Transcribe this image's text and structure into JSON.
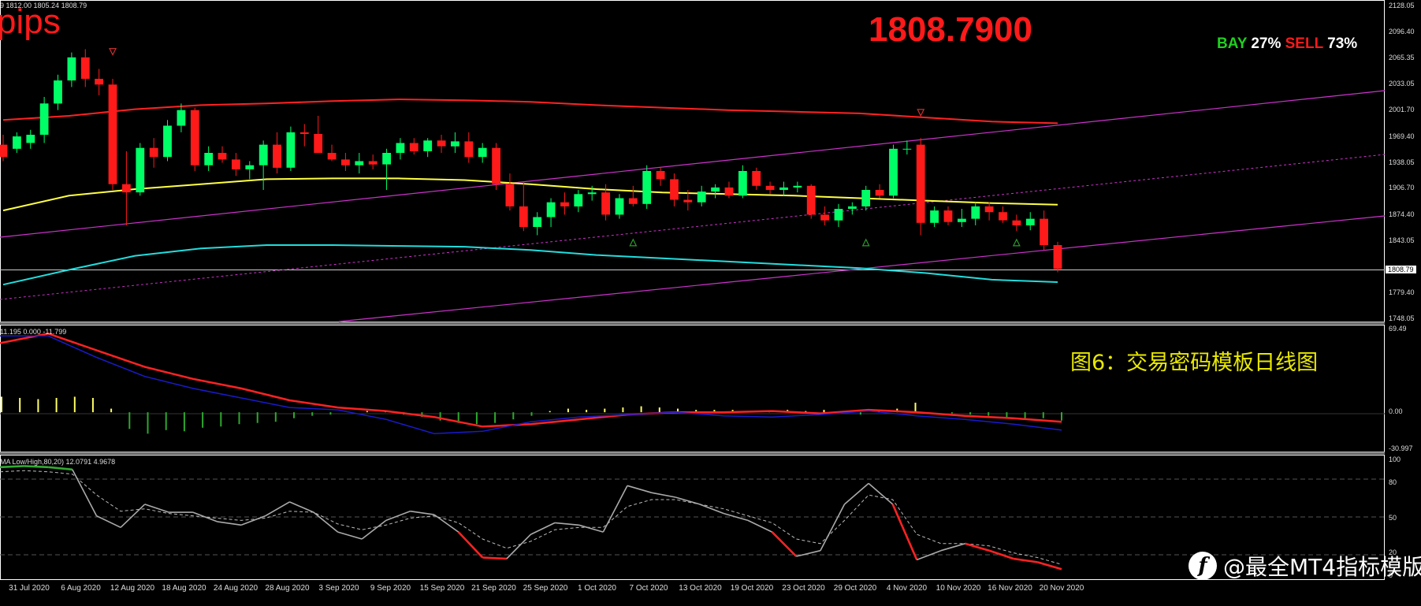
{
  "header": {
    "ohlc_text": "9 1812.00 1805.24 1808.79",
    "pips_text": "pips",
    "big_price": "1808.7900",
    "buy_label": "BAY",
    "buy_pct": "27%",
    "sell_label": "SELL",
    "sell_pct": "73%"
  },
  "caption": "图6：交易密码模板日线图",
  "macd_label": "11.195 0.000 -11.799",
  "osc_label": "MA Low/High,80,20) 12.0791 4.9678",
  "price_axis": [
    "2128.05",
    "2096.40",
    "2065.35",
    "2033.05",
    "2001.70",
    "1969.40",
    "1938.05",
    "1906.70",
    "1874.40",
    "1843.05",
    "1779.40",
    "1748.05"
  ],
  "current_price_tag": "1808.79",
  "macd_axis": [
    "69.49",
    "0.00",
    "-30.997"
  ],
  "osc_axis": [
    "100",
    "80",
    "50",
    "20",
    "0"
  ],
  "date_labels": [
    "31 Jul 2020",
    "6 Aug 2020",
    "12 Aug 2020",
    "18 Aug 2020",
    "24 Aug 2020",
    "28 Aug 2020",
    "3 Sep 2020",
    "9 Sep 2020",
    "15 Sep 2020",
    "21 Sep 2020",
    "25 Sep 2020",
    "1 Oct 2020",
    "7 Oct 2020",
    "13 Oct 2020",
    "19 Oct 2020",
    "23 Oct 2020",
    "29 Oct 2020",
    "4 Nov 2020",
    "10 Nov 2020",
    "16 Nov 2020",
    "20 Nov 2020"
  ],
  "watermark": "@最全MT4指标模版",
  "watermark_logo": "f",
  "colors": {
    "bull": "#00ff66",
    "bear": "#ff1a1a",
    "ma_red": "#ff2222",
    "ma_yellow": "#ffff44",
    "ma_cyan": "#22dddd",
    "channel": "#cc33cc",
    "macd_signal": "#ff2222",
    "macd_main": "#1a1acc",
    "osc_main": "#aaaaaa"
  },
  "chart_data": [
    {
      "type": "candlestick",
      "title": "Daily price",
      "ylim": [
        1748.05,
        2128.05
      ],
      "candles": [
        {
          "o": 1960,
          "h": 1972,
          "l": 1940,
          "c": 1945
        },
        {
          "o": 1955,
          "h": 1975,
          "l": 1950,
          "c": 1970
        },
        {
          "o": 1962,
          "h": 1978,
          "l": 1955,
          "c": 1972
        },
        {
          "o": 1972,
          "h": 2018,
          "l": 1962,
          "c": 2010
        },
        {
          "o": 2010,
          "h": 2045,
          "l": 2002,
          "c": 2038
        },
        {
          "o": 2038,
          "h": 2072,
          "l": 2030,
          "c": 2066
        },
        {
          "o": 2066,
          "h": 2076,
          "l": 2030,
          "c": 2040
        },
        {
          "o": 2040,
          "h": 2052,
          "l": 2020,
          "c": 2033
        },
        {
          "o": 2033,
          "h": 2040,
          "l": 1905,
          "c": 1912
        },
        {
          "o": 1912,
          "h": 1952,
          "l": 1862,
          "c": 1902
        },
        {
          "o": 1902,
          "h": 1962,
          "l": 1898,
          "c": 1956
        },
        {
          "o": 1956,
          "h": 1968,
          "l": 1932,
          "c": 1945
        },
        {
          "o": 1945,
          "h": 1990,
          "l": 1940,
          "c": 1983
        },
        {
          "o": 1983,
          "h": 2010,
          "l": 1975,
          "c": 2002
        },
        {
          "o": 2002,
          "h": 2005,
          "l": 1928,
          "c": 1935
        },
        {
          "o": 1935,
          "h": 1958,
          "l": 1928,
          "c": 1950
        },
        {
          "o": 1950,
          "h": 1958,
          "l": 1938,
          "c": 1942
        },
        {
          "o": 1942,
          "h": 1950,
          "l": 1922,
          "c": 1930
        },
        {
          "o": 1930,
          "h": 1940,
          "l": 1918,
          "c": 1935
        },
        {
          "o": 1935,
          "h": 1965,
          "l": 1905,
          "c": 1960
        },
        {
          "o": 1960,
          "h": 1975,
          "l": 1925,
          "c": 1932
        },
        {
          "o": 1932,
          "h": 1982,
          "l": 1928,
          "c": 1975
        },
        {
          "o": 1975,
          "h": 1985,
          "l": 1958,
          "c": 1973
        },
        {
          "o": 1973,
          "h": 1995,
          "l": 1962,
          "c": 1950
        },
        {
          "o": 1950,
          "h": 1960,
          "l": 1940,
          "c": 1942
        },
        {
          "o": 1942,
          "h": 1950,
          "l": 1928,
          "c": 1935
        },
        {
          "o": 1935,
          "h": 1950,
          "l": 1925,
          "c": 1940
        },
        {
          "o": 1940,
          "h": 1948,
          "l": 1930,
          "c": 1936
        },
        {
          "o": 1936,
          "h": 1955,
          "l": 1905,
          "c": 1950
        },
        {
          "o": 1950,
          "h": 1968,
          "l": 1942,
          "c": 1962
        },
        {
          "o": 1962,
          "h": 1968,
          "l": 1948,
          "c": 1952
        },
        {
          "o": 1952,
          "h": 1968,
          "l": 1945,
          "c": 1965
        },
        {
          "o": 1965,
          "h": 1972,
          "l": 1950,
          "c": 1958
        },
        {
          "o": 1958,
          "h": 1975,
          "l": 1950,
          "c": 1964
        },
        {
          "o": 1964,
          "h": 1975,
          "l": 1938,
          "c": 1945
        },
        {
          "o": 1945,
          "h": 1962,
          "l": 1938,
          "c": 1956
        },
        {
          "o": 1956,
          "h": 1962,
          "l": 1905,
          "c": 1912
        },
        {
          "o": 1912,
          "h": 1925,
          "l": 1880,
          "c": 1885
        },
        {
          "o": 1885,
          "h": 1915,
          "l": 1855,
          "c": 1860
        },
        {
          "o": 1860,
          "h": 1878,
          "l": 1850,
          "c": 1872
        },
        {
          "o": 1872,
          "h": 1895,
          "l": 1860,
          "c": 1890
        },
        {
          "o": 1890,
          "h": 1902,
          "l": 1875,
          "c": 1885
        },
        {
          "o": 1885,
          "h": 1905,
          "l": 1878,
          "c": 1900
        },
        {
          "o": 1900,
          "h": 1910,
          "l": 1892,
          "c": 1902
        },
        {
          "o": 1902,
          "h": 1912,
          "l": 1868,
          "c": 1875
        },
        {
          "o": 1875,
          "h": 1900,
          "l": 1870,
          "c": 1895
        },
        {
          "o": 1895,
          "h": 1910,
          "l": 1885,
          "c": 1888
        },
        {
          "o": 1888,
          "h": 1935,
          "l": 1882,
          "c": 1928
        },
        {
          "o": 1928,
          "h": 1932,
          "l": 1910,
          "c": 1918
        },
        {
          "o": 1918,
          "h": 1925,
          "l": 1885,
          "c": 1893
        },
        {
          "o": 1893,
          "h": 1905,
          "l": 1880,
          "c": 1890
        },
        {
          "o": 1890,
          "h": 1910,
          "l": 1885,
          "c": 1903
        },
        {
          "o": 1903,
          "h": 1912,
          "l": 1895,
          "c": 1908
        },
        {
          "o": 1908,
          "h": 1915,
          "l": 1895,
          "c": 1898
        },
        {
          "o": 1898,
          "h": 1935,
          "l": 1895,
          "c": 1928
        },
        {
          "o": 1928,
          "h": 1932,
          "l": 1905,
          "c": 1910
        },
        {
          "o": 1910,
          "h": 1915,
          "l": 1900,
          "c": 1905
        },
        {
          "o": 1905,
          "h": 1915,
          "l": 1898,
          "c": 1908
        },
        {
          "o": 1908,
          "h": 1915,
          "l": 1902,
          "c": 1910
        },
        {
          "o": 1910,
          "h": 1912,
          "l": 1870,
          "c": 1875
        },
        {
          "o": 1875,
          "h": 1885,
          "l": 1862,
          "c": 1868
        },
        {
          "o": 1868,
          "h": 1888,
          "l": 1860,
          "c": 1882
        },
        {
          "o": 1882,
          "h": 1890,
          "l": 1875,
          "c": 1885
        },
        {
          "o": 1885,
          "h": 1910,
          "l": 1880,
          "c": 1905
        },
        {
          "o": 1905,
          "h": 1912,
          "l": 1895,
          "c": 1898
        },
        {
          "o": 1898,
          "h": 1960,
          "l": 1895,
          "c": 1955
        },
        {
          "o": 1955,
          "h": 1965,
          "l": 1948,
          "c": 1955
        },
        {
          "o": 1960,
          "h": 1968,
          "l": 1850,
          "c": 1865
        },
        {
          "o": 1865,
          "h": 1885,
          "l": 1860,
          "c": 1880
        },
        {
          "o": 1880,
          "h": 1885,
          "l": 1862,
          "c": 1866
        },
        {
          "o": 1866,
          "h": 1882,
          "l": 1860,
          "c": 1870
        },
        {
          "o": 1870,
          "h": 1890,
          "l": 1862,
          "c": 1885
        },
        {
          "o": 1885,
          "h": 1890,
          "l": 1868,
          "c": 1878
        },
        {
          "o": 1878,
          "h": 1885,
          "l": 1865,
          "c": 1868
        },
        {
          "o": 1868,
          "h": 1875,
          "l": 1855,
          "c": 1862
        },
        {
          "o": 1862,
          "h": 1878,
          "l": 1856,
          "c": 1870
        },
        {
          "o": 1870,
          "h": 1880,
          "l": 1832,
          "c": 1838
        },
        {
          "o": 1838,
          "h": 1842,
          "l": 1805,
          "c": 1809
        }
      ],
      "moving_averages": [
        {
          "name": "MA red",
          "values": [
            1990,
            1995,
            2003,
            2008,
            2010,
            2013,
            2015,
            2014,
            2012,
            2008,
            2005,
            2002,
            2000,
            1998,
            1993,
            1988,
            1986
          ]
        },
        {
          "name": "MA yellow",
          "values": [
            1880,
            1898,
            1906,
            1912,
            1918,
            1919,
            1919,
            1917,
            1912,
            1906,
            1902,
            1900,
            1898,
            1895,
            1892,
            1889,
            1887
          ]
        },
        {
          "name": "MA cyan",
          "values": [
            1790,
            1808,
            1825,
            1834,
            1838,
            1838,
            1837,
            1836,
            1832,
            1826,
            1822,
            1818,
            1814,
            1810,
            1804,
            1796,
            1793
          ]
        }
      ],
      "current_price": 1808.79
    },
    {
      "type": "bar",
      "title": "MACD",
      "ylim": [
        -30.997,
        69.49
      ],
      "histogram": [
        13,
        12,
        11,
        12,
        13,
        12,
        3,
        -14,
        -18,
        -15,
        -16,
        -13,
        -12,
        -10,
        -9,
        -8,
        -5,
        -3,
        -2,
        0,
        1,
        1,
        -2,
        -4,
        -7,
        -9,
        -10,
        -9,
        -6,
        -3,
        1,
        3,
        2,
        3,
        4,
        5,
        4,
        3,
        2,
        2,
        2,
        1,
        1,
        2,
        1,
        2,
        -1,
        -2,
        1,
        3,
        8,
        0,
        -1,
        -2,
        -3,
        -4,
        -6,
        -5,
        -7
      ],
      "series": [
        {
          "name": "signal",
          "values": [
            58,
            66,
            52,
            38,
            28,
            20,
            10,
            4,
            1,
            -4,
            -12,
            -10,
            -6,
            -2,
            0,
            0,
            1,
            -1,
            2,
            0,
            -3,
            -5,
            -8
          ]
        },
        {
          "name": "main",
          "values": [
            64,
            64,
            46,
            30,
            20,
            12,
            4,
            2,
            -6,
            -18,
            -16,
            -8,
            -4,
            -2,
            0,
            -3,
            -4,
            -2,
            1,
            -3,
            -6,
            -10,
            -15
          ]
        }
      ]
    },
    {
      "type": "line",
      "title": "Oscillator",
      "ylim": [
        0,
        100
      ],
      "series": [
        {
          "name": "main",
          "values": [
            94,
            95,
            94,
            92,
            52,
            42,
            62,
            55,
            55,
            47,
            44,
            52,
            64,
            55,
            38,
            32,
            48,
            56,
            53,
            38,
            16,
            15,
            36,
            46,
            44,
            38,
            78,
            72,
            68,
            62,
            54,
            48,
            38,
            17,
            22,
            62,
            80,
            62,
            14,
            22,
            28,
            22,
            15,
            12,
            6
          ]
        },
        {
          "name": "signal",
          "values": [
            90,
            91,
            90,
            88,
            70,
            56,
            58,
            54,
            52,
            50,
            48,
            50,
            56,
            55,
            45,
            40,
            44,
            50,
            52,
            46,
            32,
            24,
            30,
            40,
            42,
            42,
            60,
            66,
            66,
            62,
            58,
            52,
            46,
            32,
            28,
            48,
            70,
            66,
            36,
            28,
            28,
            26,
            20,
            16,
            10
          ]
        }
      ]
    }
  ]
}
